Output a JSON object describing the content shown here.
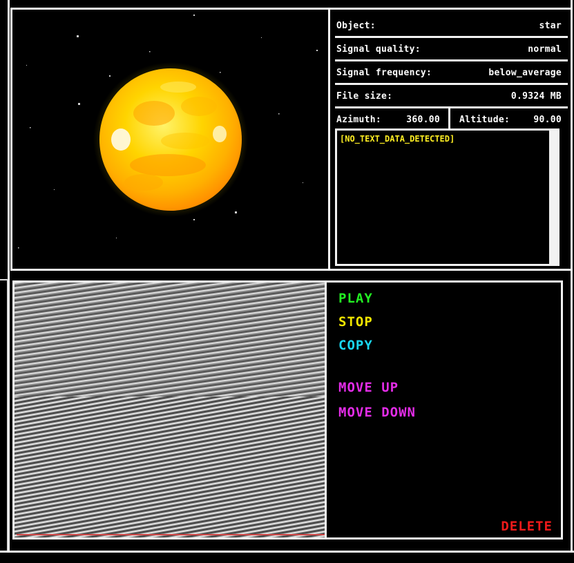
{
  "info": {
    "object_label": "Object:",
    "object_value": "star",
    "signal_quality_label": "Signal quality:",
    "signal_quality_value": "normal",
    "signal_frequency_label": "Signal frequency:",
    "signal_frequency_value": "below_average",
    "file_size_label": "File size:",
    "file_size_value": "0.9324 MB",
    "azimuth_label": "Azimuth:",
    "azimuth_value": "360.00",
    "altitude_label": "Altitude:",
    "altitude_value": "90.00"
  },
  "text_box": {
    "content": "[NO_TEXT_DATA_DETECTED]"
  },
  "controls": {
    "play": "PLAY",
    "stop": "STOP",
    "copy": "COPY",
    "move_up": "MOVE UP",
    "move_down": "MOVE DOWN",
    "delete": "DELETE"
  },
  "colors": {
    "play": "#22ee22",
    "stop": "#f2e600",
    "copy": "#19d6f0",
    "move": "#e22ce6",
    "delete": "#ee1a1a",
    "text_data": "#ffee22",
    "star_core": "#ffe000",
    "star_warm": "#ff9a00"
  },
  "icons": {
    "star_image": "pixel-star-icon",
    "signal_image": "signal-waveform-icon"
  }
}
